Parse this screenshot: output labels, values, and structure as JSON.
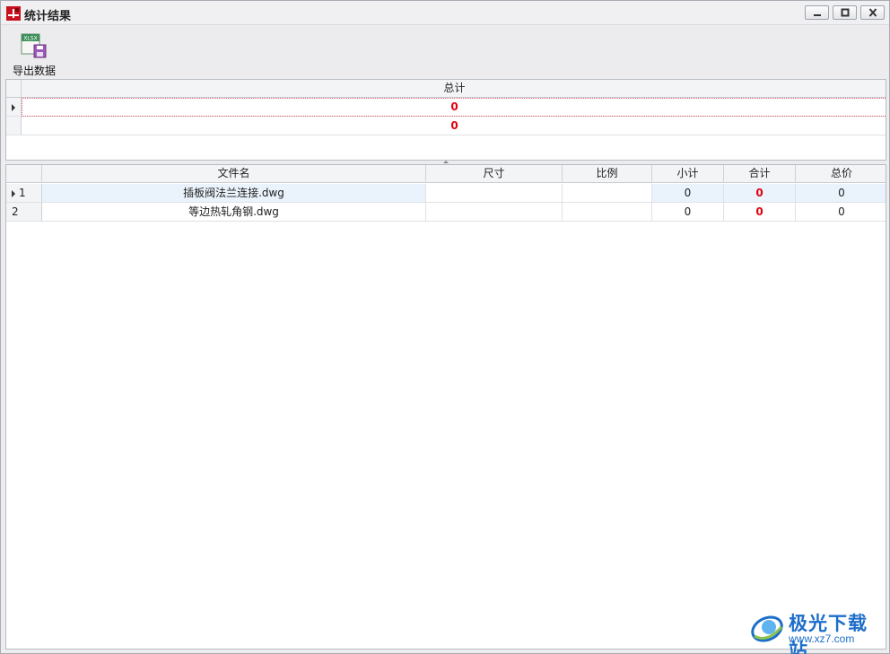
{
  "window": {
    "title": "统计结果",
    "icon": "cad-app-icon",
    "controls": [
      "minimize-icon",
      "maximize-icon",
      "close-icon"
    ]
  },
  "toolbar": {
    "export_label": "导出数据",
    "export_icon": "xlsx-save-icon",
    "export_icon_text": "XLSX"
  },
  "summary_grid": {
    "header": "总计",
    "rows": [
      {
        "value": "0"
      },
      {
        "value": "0"
      }
    ]
  },
  "file_grid": {
    "headers": {
      "name": "文件名",
      "size": "尺寸",
      "scale": "比例",
      "subtotal": "小计",
      "total": "合计",
      "total_price": "总价"
    },
    "rows": [
      {
        "index": "1",
        "name": "插板阀法兰连接.dwg",
        "size": "",
        "scale": "",
        "subtotal": "0",
        "total": "0",
        "total_price": "0"
      },
      {
        "index": "2",
        "name": "等边热轧角钢.dwg",
        "size": "",
        "scale": "",
        "subtotal": "0",
        "total": "0",
        "total_price": "0"
      }
    ]
  },
  "watermark": {
    "text": "极光下载站",
    "url": "www.xz7.com"
  },
  "colors": {
    "accent_red": "#e0000f",
    "watermark_blue": "#1d6ec9"
  }
}
